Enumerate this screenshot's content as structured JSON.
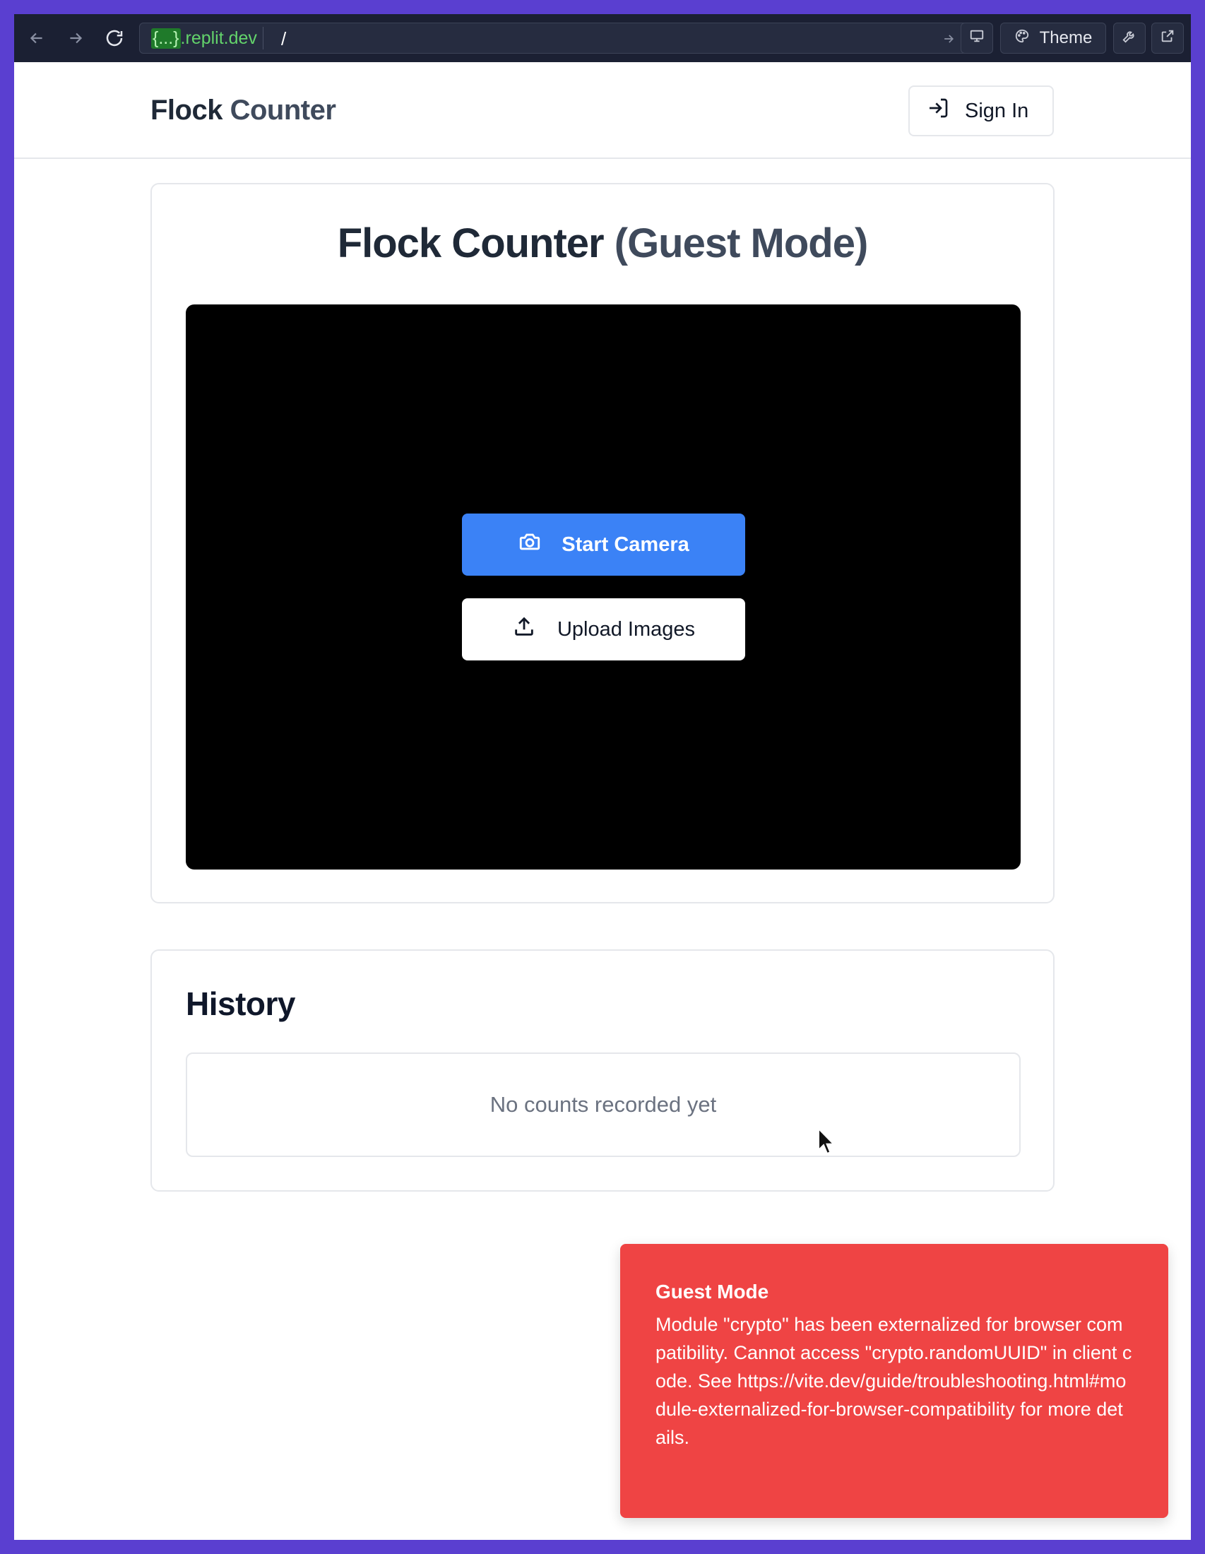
{
  "browser": {
    "url_domain_highlight": "{...}",
    "url_domain_rest": ".replit.dev",
    "url_path": "/",
    "theme_label": "Theme"
  },
  "header": {
    "brand_part1": "Flock",
    "brand_part2": "Counter",
    "signin_label": "Sign In"
  },
  "main": {
    "title_part1": "Flock Counter",
    "title_part2": "(Guest Mode)",
    "start_camera_label": "Start Camera",
    "upload_images_label": "Upload Images"
  },
  "history": {
    "title": "History",
    "empty_message": "No counts recorded yet"
  },
  "toast": {
    "title": "Guest Mode",
    "message": "Module \"crypto\" has been externalized for browser compatibility. Cannot access \"crypto.randomUUID\" in client code. See https://vite.dev/guide/troubleshooting.html#module-externalized-for-browser-compatibility for more details."
  },
  "colors": {
    "frame": "#5a3fd0",
    "primary_button": "#3b82f6",
    "toast_bg": "#ef4444"
  }
}
